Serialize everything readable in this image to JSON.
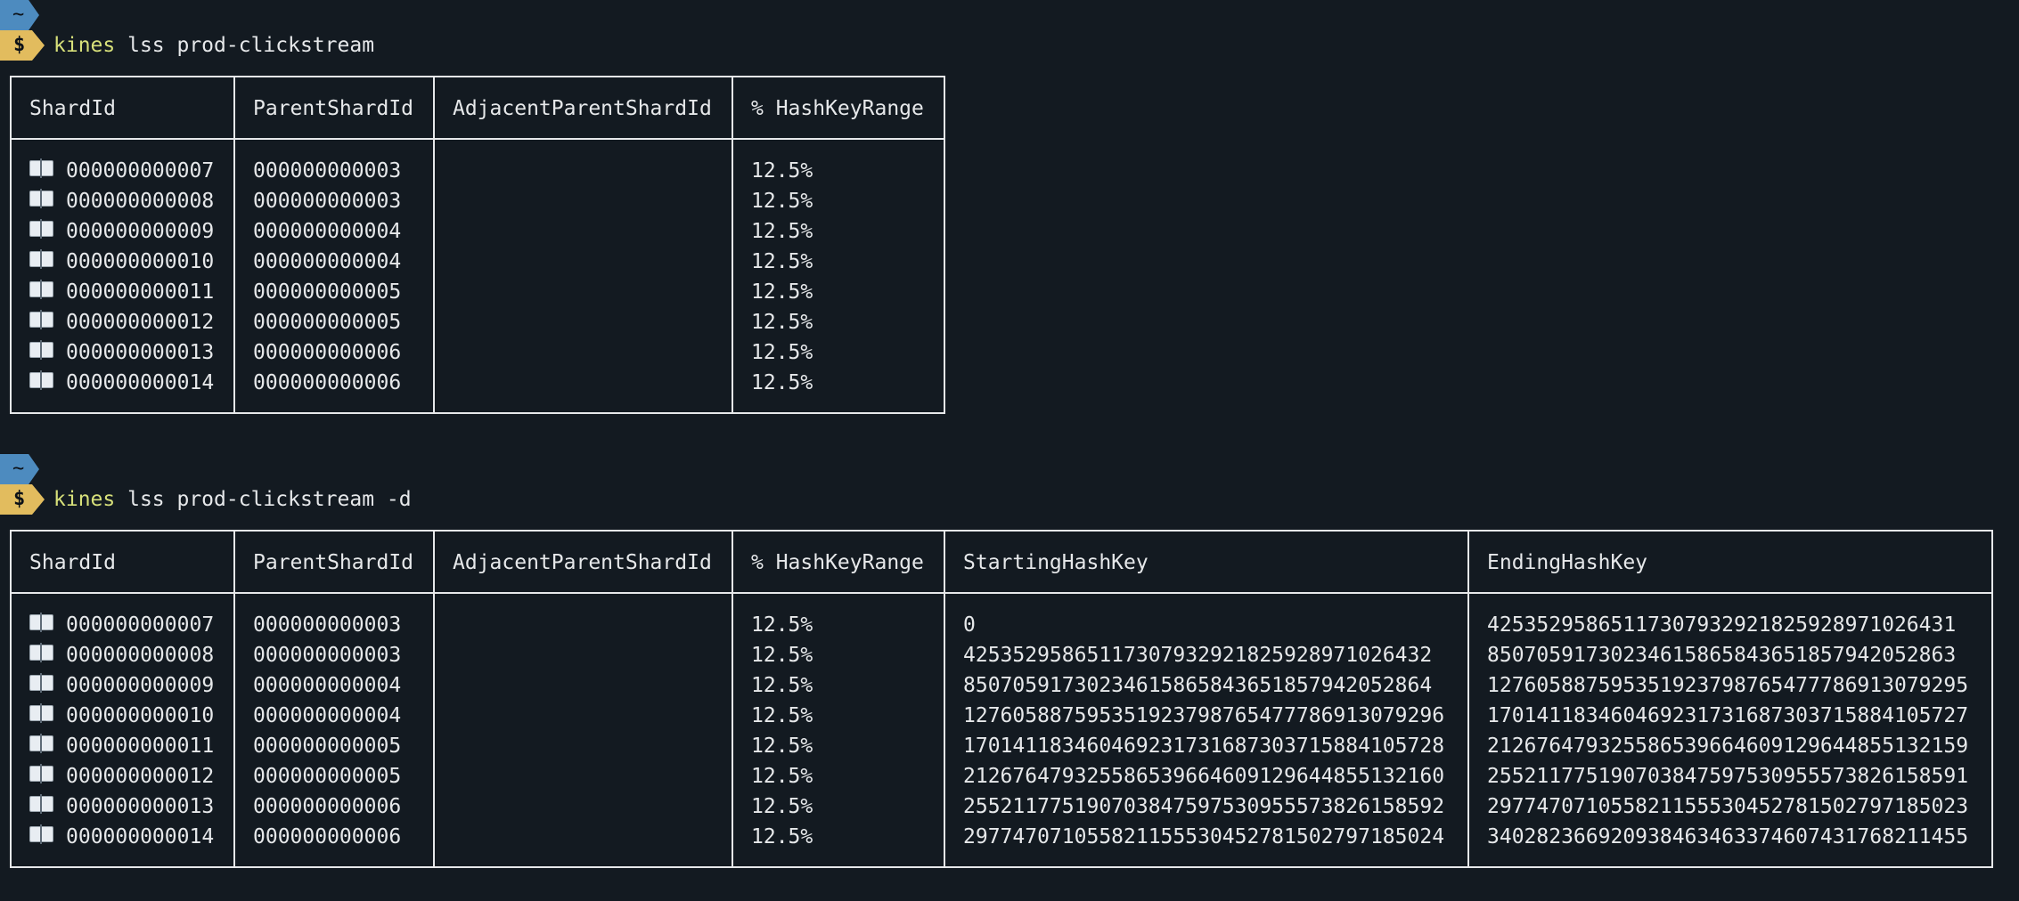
{
  "sessions": [
    {
      "prompt_dir": "~",
      "prompt_symbol": "$",
      "command_name": "kines",
      "command_args": " lss prod-clickstream",
      "table": {
        "headers": [
          "ShardId",
          "ParentShardId",
          "AdjacentParentShardId",
          "% HashKeyRange"
        ],
        "rows": [
          {
            "shard_id": "000000000007",
            "parent": "000000000003",
            "adjacent": "",
            "range": "12.5%"
          },
          {
            "shard_id": "000000000008",
            "parent": "000000000003",
            "adjacent": "",
            "range": "12.5%"
          },
          {
            "shard_id": "000000000009",
            "parent": "000000000004",
            "adjacent": "",
            "range": "12.5%"
          },
          {
            "shard_id": "000000000010",
            "parent": "000000000004",
            "adjacent": "",
            "range": "12.5%"
          },
          {
            "shard_id": "000000000011",
            "parent": "000000000005",
            "adjacent": "",
            "range": "12.5%"
          },
          {
            "shard_id": "000000000012",
            "parent": "000000000005",
            "adjacent": "",
            "range": "12.5%"
          },
          {
            "shard_id": "000000000013",
            "parent": "000000000006",
            "adjacent": "",
            "range": "12.5%"
          },
          {
            "shard_id": "000000000014",
            "parent": "000000000006",
            "adjacent": "",
            "range": "12.5%"
          }
        ]
      }
    },
    {
      "prompt_dir": "~",
      "prompt_symbol": "$",
      "command_name": "kines",
      "command_args": " lss prod-clickstream -d",
      "table": {
        "headers": [
          "ShardId",
          "ParentShardId",
          "AdjacentParentShardId",
          "% HashKeyRange",
          "StartingHashKey",
          "EndingHashKey"
        ],
        "rows": [
          {
            "shard_id": "000000000007",
            "parent": "000000000003",
            "adjacent": "",
            "range": "12.5%",
            "start": "0",
            "end": "42535295865117307932921825928971026431"
          },
          {
            "shard_id": "000000000008",
            "parent": "000000000003",
            "adjacent": "",
            "range": "12.5%",
            "start": "42535295865117307932921825928971026432",
            "end": "85070591730234615865843651857942052863"
          },
          {
            "shard_id": "000000000009",
            "parent": "000000000004",
            "adjacent": "",
            "range": "12.5%",
            "start": "85070591730234615865843651857942052864",
            "end": "127605887595351923798765477786913079295"
          },
          {
            "shard_id": "000000000010",
            "parent": "000000000004",
            "adjacent": "",
            "range": "12.5%",
            "start": "127605887595351923798765477786913079296",
            "end": "170141183460469231731687303715884105727"
          },
          {
            "shard_id": "000000000011",
            "parent": "000000000005",
            "adjacent": "",
            "range": "12.5%",
            "start": "170141183460469231731687303715884105728",
            "end": "212676479325586539664609129644855132159"
          },
          {
            "shard_id": "000000000012",
            "parent": "000000000005",
            "adjacent": "",
            "range": "12.5%",
            "start": "212676479325586539664609129644855132160",
            "end": "255211775190703847597530955573826158591"
          },
          {
            "shard_id": "000000000013",
            "parent": "000000000006",
            "adjacent": "",
            "range": "12.5%",
            "start": "255211775190703847597530955573826158592",
            "end": "297747071055821155530452781502797185023"
          },
          {
            "shard_id": "000000000014",
            "parent": "000000000006",
            "adjacent": "",
            "range": "12.5%",
            "start": "297747071055821155530452781502797185024",
            "end": "340282366920938463463374607431768211455"
          }
        ]
      }
    }
  ],
  "icons": {
    "shard_icon": "open-book-icon"
  },
  "colors": {
    "background": "#131a21",
    "text": "#e6e8ea",
    "command": "#d7e07a",
    "dir_tag": "#4d8bbf",
    "prompt_tag": "#e2bc5e"
  }
}
